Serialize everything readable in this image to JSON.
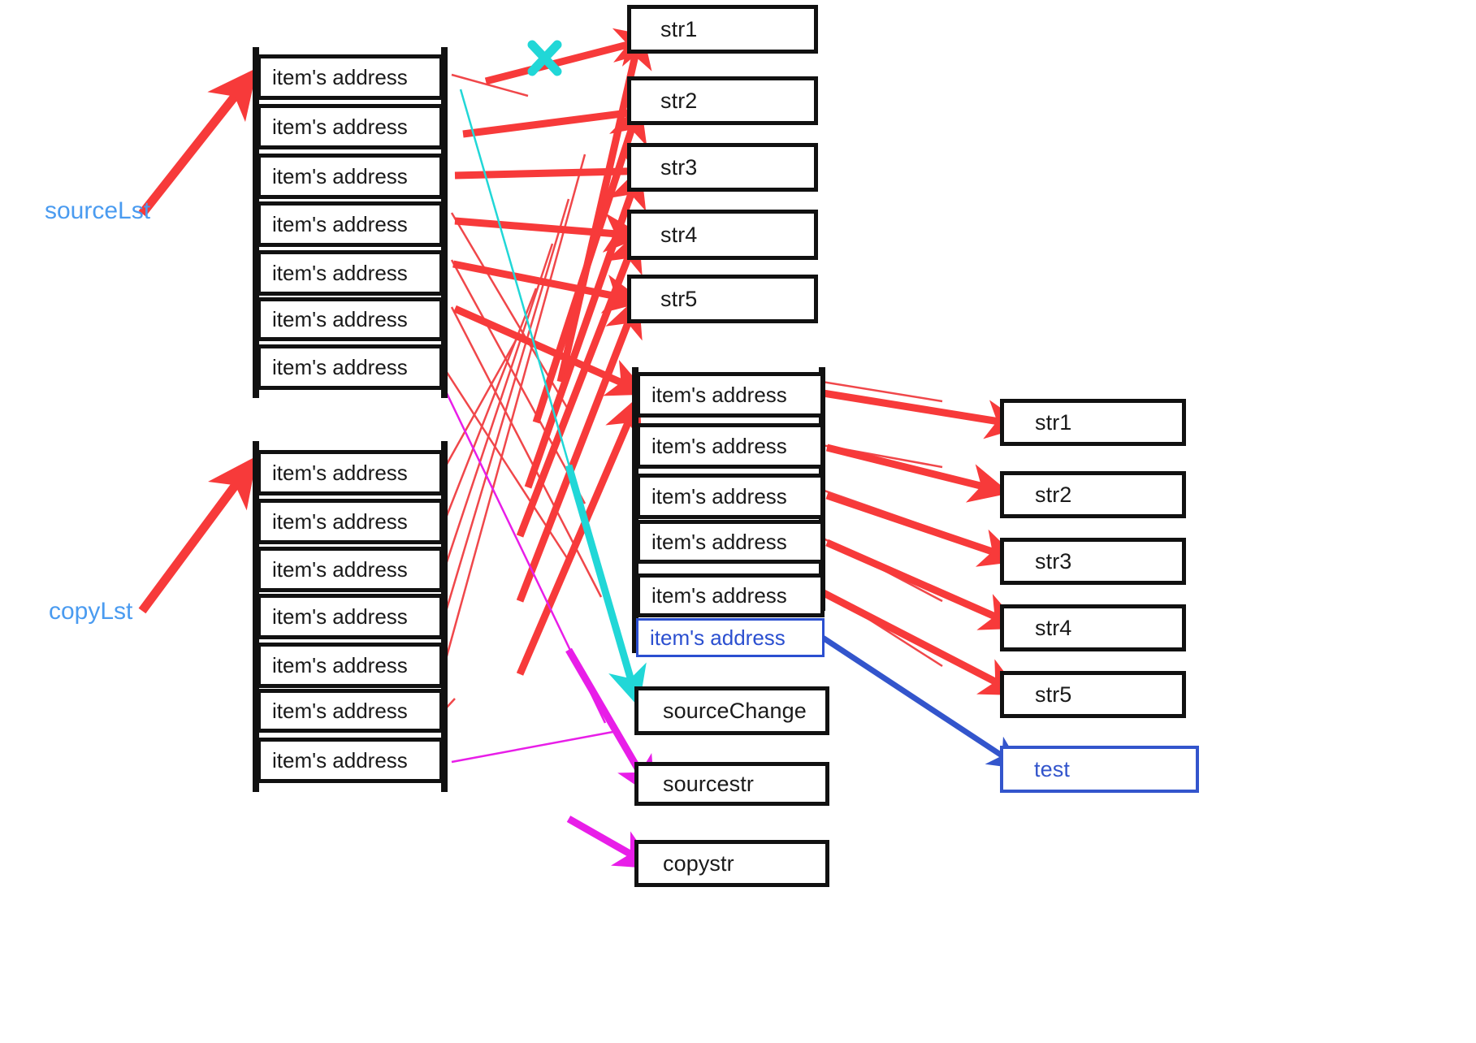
{
  "diagram": {
    "title": "list copy / shallow copy memory reference diagram",
    "colors": {
      "red_arrow": "#f73a3a",
      "thin_red": "#f0474a",
      "cyan": "#21d7d7",
      "magenta": "#e81ee8",
      "blue": "#3355cc",
      "label_blue": "#4a9bf0",
      "box_border": "#111111"
    }
  },
  "labels": [
    {
      "name": "sourceLst",
      "text": "sourceLst"
    },
    {
      "name": "copyLst",
      "text": "copyLst"
    }
  ],
  "source_list": {
    "label": "sourceLst",
    "items": [
      "item's address",
      "item's address",
      "item's address",
      "item's address",
      "item's address",
      "item's address",
      "item's address"
    ]
  },
  "copy_list": {
    "label": "copyLst",
    "items": [
      "item's address",
      "item's address",
      "item's address",
      "item's address",
      "item's address",
      "item's address",
      "item's address"
    ]
  },
  "middle_list": {
    "items": [
      {
        "text": "item's address",
        "style": "black"
      },
      {
        "text": "item's address",
        "style": "black"
      },
      {
        "text": "item's address",
        "style": "black"
      },
      {
        "text": "item's address",
        "style": "black"
      },
      {
        "text": "item's address",
        "style": "black"
      },
      {
        "text": "item's address",
        "style": "blue"
      }
    ]
  },
  "top_strings": [
    {
      "text": "str1"
    },
    {
      "text": "str2"
    },
    {
      "text": "str3"
    },
    {
      "text": "str4"
    },
    {
      "text": "str5"
    }
  ],
  "right_strings": [
    {
      "text": "str1"
    },
    {
      "text": "str2"
    },
    {
      "text": "str3"
    },
    {
      "text": "str4"
    },
    {
      "text": "str5"
    }
  ],
  "misc_boxes": [
    {
      "name": "sourceChange",
      "text": "sourceChange"
    },
    {
      "name": "sourcestr",
      "text": "sourcestr"
    },
    {
      "name": "copystr",
      "text": "copystr"
    }
  ],
  "test_box": {
    "text": "test"
  },
  "marks": [
    {
      "name": "cross-mark",
      "symbol": "X",
      "color": "#21d7d7"
    }
  ]
}
